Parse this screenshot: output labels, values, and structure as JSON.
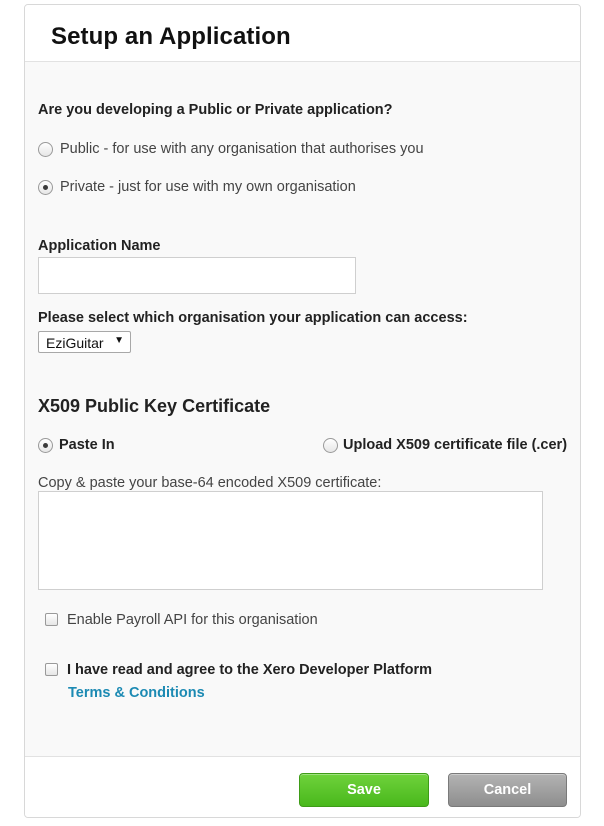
{
  "dialog": {
    "title": "Setup an Application"
  },
  "app_type": {
    "question": "Are you developing a Public or Private application?",
    "options": [
      {
        "label": "Public - for use with any organisation that authorises you",
        "selected": false
      },
      {
        "label": "Private - just for use with my own organisation",
        "selected": true
      }
    ]
  },
  "app_name": {
    "label": "Application Name",
    "value": "",
    "placeholder": ""
  },
  "organisation": {
    "label": "Please select which organisation your application can access:",
    "selected": "EziGuitar"
  },
  "certificate": {
    "title": "X509 Public Key Certificate",
    "options": [
      {
        "label": "Paste In",
        "selected": true
      },
      {
        "label": "Upload X509 certificate file (.cer)",
        "selected": false
      }
    ],
    "paste_label": "Copy & paste your base-64 encoded X509 certificate:",
    "paste_value": ""
  },
  "payroll": {
    "label": "Enable Payroll API for this organisation",
    "checked": false
  },
  "terms": {
    "label": "I have read and agree to the Xero Developer Platform",
    "link_text": "Terms & Conditions",
    "checked": false
  },
  "footer": {
    "save_label": "Save",
    "cancel_label": "Cancel"
  },
  "colors": {
    "save_green": "#49b81c",
    "cancel_gray": "#8e8e8e",
    "link_blue": "#1c8ab3"
  }
}
